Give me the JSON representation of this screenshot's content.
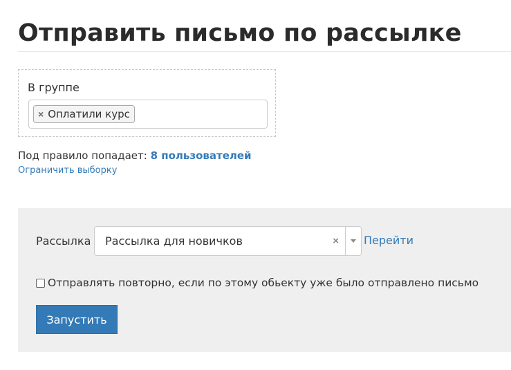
{
  "page": {
    "title": "Отправить письмо по рассылке"
  },
  "filter": {
    "label": "В группе",
    "tags": [
      {
        "remove_symbol": "×",
        "label": "Оплатили курс"
      }
    ]
  },
  "summary": {
    "prefix": "Под правило попадает:",
    "count_text": "8 пользователей",
    "limit_link": "Ограничить выборку"
  },
  "form": {
    "mailing_label": "Рассылка",
    "mailing_selected": "Рассылка для новичков",
    "clear_symbol": "×",
    "goto_link": "Перейти",
    "resend_checked": false,
    "resend_label": "Отправлять повторно, если по этому обьекту уже было отправлено письмо",
    "run_button": "Запустить"
  },
  "colors": {
    "accent": "#337ab7",
    "panel_background": "#efefef"
  }
}
